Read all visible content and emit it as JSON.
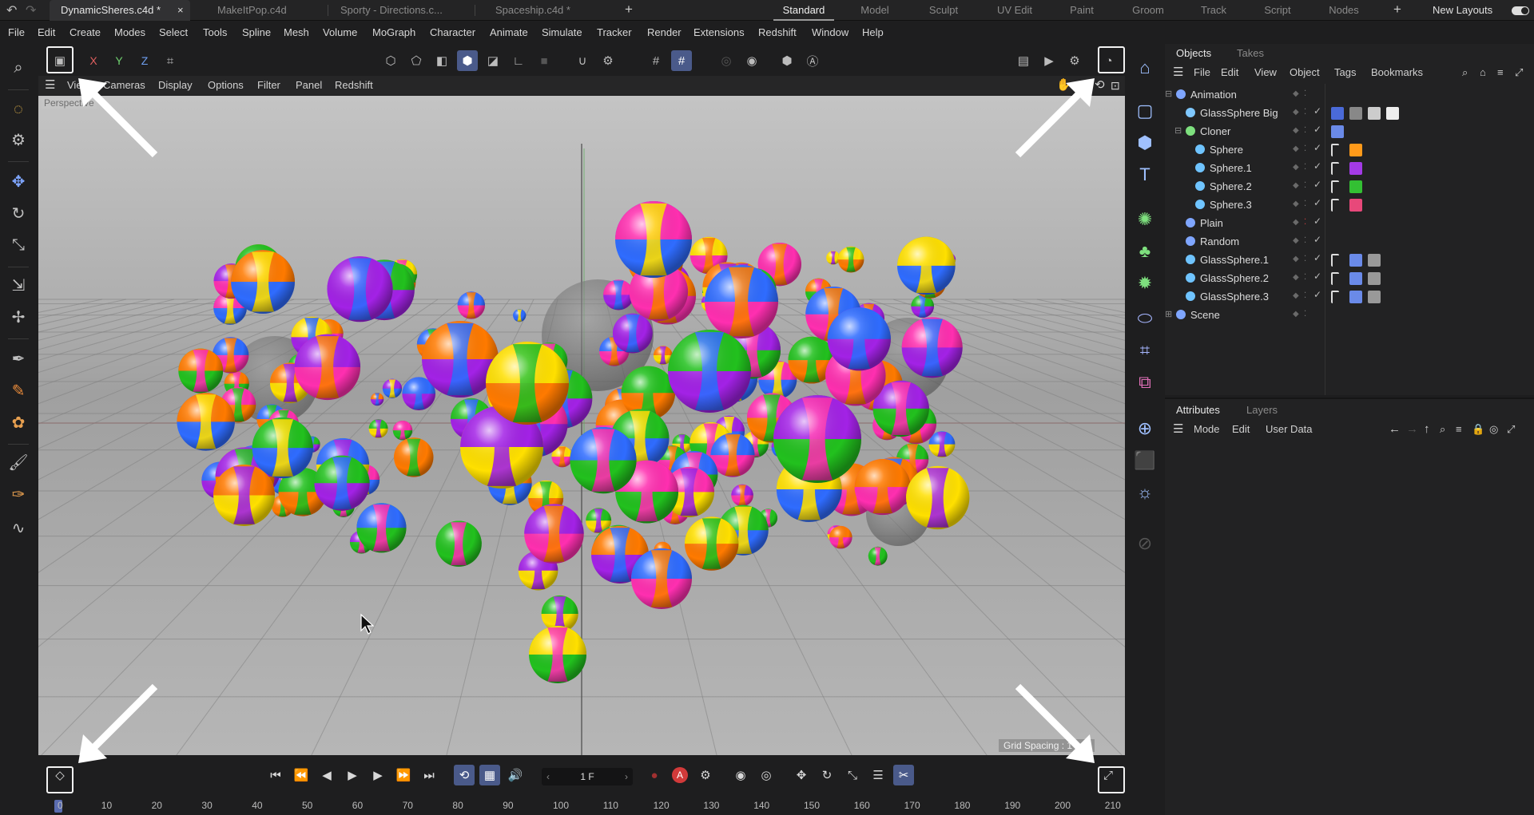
{
  "tabs": {
    "documents": [
      {
        "label": "DynamicSheres.c4d *",
        "active": true,
        "close": "×"
      },
      {
        "label": "MakeItPop.c4d"
      },
      {
        "label": "Sporty - Directions.c..."
      },
      {
        "label": "Spaceship.c4d *"
      }
    ],
    "new_tab": "+",
    "layouts": [
      "Standard",
      "Model",
      "Sculpt",
      "UV Edit",
      "Paint",
      "Groom",
      "Track",
      "Script",
      "Nodes"
    ],
    "layout_add": "+",
    "new_layouts": "New Layouts"
  },
  "menu": [
    "File",
    "Edit",
    "Create",
    "Modes",
    "Select",
    "Tools",
    "Spline",
    "Mesh",
    "Volume",
    "MoGraph",
    "Character",
    "Animate",
    "Simulate",
    "Tracker",
    "Render",
    "Extensions",
    "Redshift",
    "Window",
    "Help"
  ],
  "toolbar": {
    "axis_x": "X",
    "axis_y": "Y",
    "axis_z": "Z"
  },
  "viewport_menu": [
    "View",
    "Cameras",
    "Display",
    "Options",
    "Filter",
    "Panel",
    "Redshift"
  ],
  "viewport": {
    "camera_label": "Perspective",
    "grid_spacing": "Grid Spacing : 1 cm"
  },
  "objects_panel": {
    "tabs": [
      "Objects",
      "Takes"
    ],
    "menu": [
      "File",
      "Edit",
      "View",
      "Object",
      "Tags",
      "Bookmarks"
    ],
    "rows": [
      {
        "name": "Animation",
        "indent": 0,
        "expander": "⊟",
        "icon_color": "#7fa6ff"
      },
      {
        "name": "GlassSphere Big",
        "indent": 1,
        "icon_color": "#7fc8ff"
      },
      {
        "name": "Cloner",
        "indent": 1,
        "expander": "⊟",
        "icon_color": "#7ee07e"
      },
      {
        "name": "Sphere",
        "indent": 2,
        "icon_color": "#6fc4ff"
      },
      {
        "name": "Sphere.1",
        "indent": 2,
        "icon_color": "#6fc4ff"
      },
      {
        "name": "Sphere.2",
        "indent": 2,
        "icon_color": "#6fc4ff"
      },
      {
        "name": "Sphere.3",
        "indent": 2,
        "icon_color": "#6fc4ff"
      },
      {
        "name": "Plain",
        "indent": 1,
        "icon_color": "#7fa6ff"
      },
      {
        "name": "Random",
        "indent": 1,
        "icon_color": "#7fa6ff"
      },
      {
        "name": "GlassSphere.1",
        "indent": 1,
        "icon_color": "#6fc4ff"
      },
      {
        "name": "GlassSphere.2",
        "indent": 1,
        "icon_color": "#6fc4ff"
      },
      {
        "name": "GlassSphere.3",
        "indent": 1,
        "icon_color": "#6fc4ff"
      },
      {
        "name": "Scene",
        "indent": 0,
        "expander": "⊞",
        "icon_color": "#7fa6ff"
      }
    ]
  },
  "attributes_panel": {
    "tabs": [
      "Attributes",
      "Layers"
    ],
    "menu": [
      "Mode",
      "Edit",
      "User Data"
    ]
  },
  "timeline": {
    "current_frame": "1 F",
    "ticks": [
      "0",
      "10",
      "20",
      "30",
      "40",
      "50",
      "60",
      "70",
      "80",
      "90",
      "100",
      "110",
      "120",
      "130",
      "140",
      "150",
      "160",
      "170",
      "180",
      "190",
      "200",
      "210"
    ]
  },
  "colors": {
    "accent": "#4a5a8a",
    "sphere_palette": [
      "#ff7a00",
      "#ffe000",
      "#22c11e",
      "#a322e6",
      "#ff2fb0",
      "#2f6cff"
    ]
  }
}
